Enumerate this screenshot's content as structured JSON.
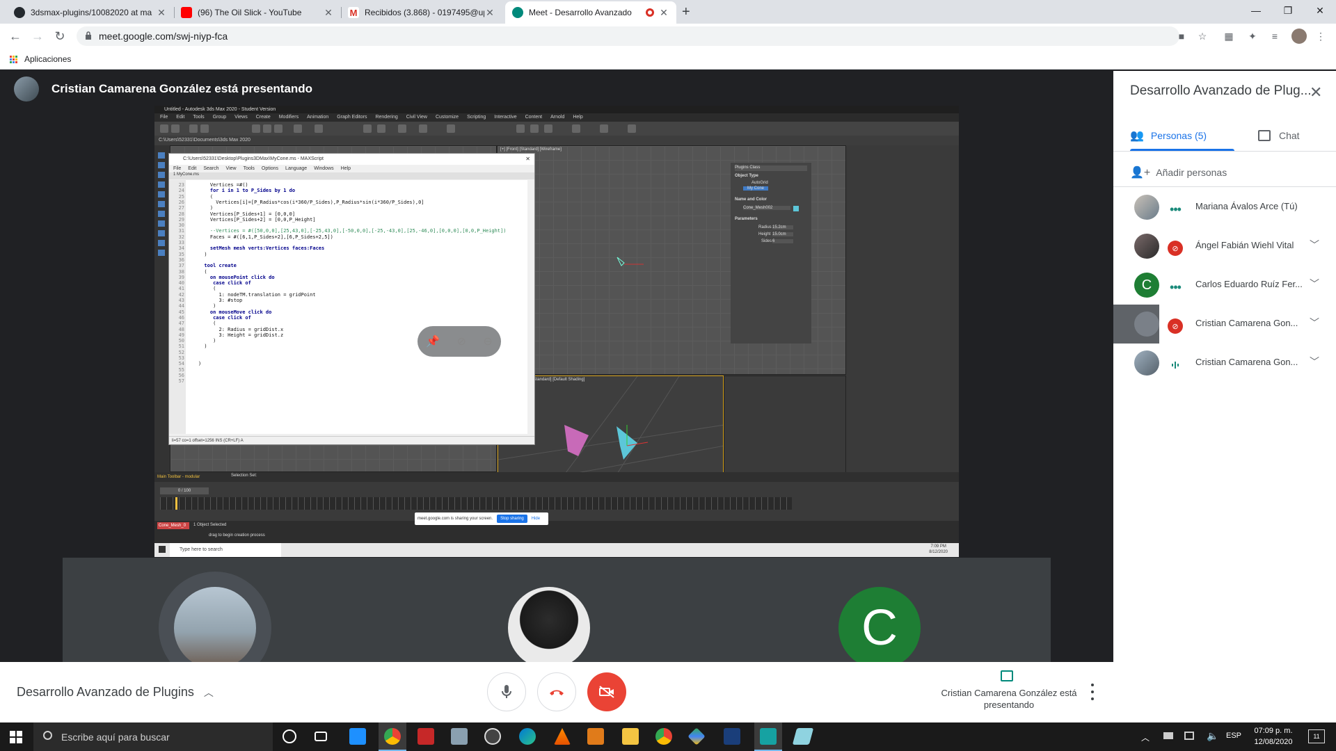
{
  "browser": {
    "tabs": [
      {
        "label": "3dsmax-plugins/10082020 at ma",
        "favicon_color": "#24292e"
      },
      {
        "label": "(96) The Oil Slick - YouTube",
        "favicon_color": "#ff0000"
      },
      {
        "label": "Recibidos (3.868) - 0197495@up",
        "favicon_color": "#d93025"
      },
      {
        "label": "Meet - Desarrollo Avanzado",
        "favicon_color": "#00897b"
      }
    ],
    "url": "meet.google.com/swj-niyp-fca",
    "bookmark_apps": "Aplicaciones"
  },
  "meet": {
    "presenter_header": "Cristian Camarena González está presentando",
    "meeting_title": "Desarrollo Avanzado de Plugins",
    "presenting_status": "Cristian Camarena González está presentando",
    "accent": "#1a73e8",
    "end_call_color": "#ea4335"
  },
  "shared_screen": {
    "max_title": "Untitled - Autodesk 3ds Max 2020 - Student Version",
    "max_menu": [
      "File",
      "Edit",
      "Tools",
      "Group",
      "Views",
      "Create",
      "Modifiers",
      "Animation",
      "Graph Editors",
      "Rendering",
      "Civil View",
      "Customize",
      "Scripting",
      "Interactive",
      "Content",
      "Arnold",
      "Help"
    ],
    "max_path": "C:\\Users\\52331\\Documents\\3ds Max 2020",
    "editor_title": "C:\\Users\\52331\\Desktop\\Plugins3DMax\\MyCone.ms - MAXScript",
    "editor_menu": [
      "File",
      "Edit",
      "Search",
      "View",
      "Tools",
      "Options",
      "Language",
      "Windows",
      "Help"
    ],
    "editor_tab": "1 MyCone.ms",
    "code_lines": [
      {
        "n": "23",
        "text": "    Vertices =#()"
      },
      {
        "n": "24",
        "text": "    for i in 1 to P_Sides by 1 do"
      },
      {
        "n": "25",
        "text": "    ("
      },
      {
        "n": "26",
        "text": "      Vertices[i]=[P_Radius*cos(i*360/P_Sides),P_Radius*sin(i*360/P_Sides),0]"
      },
      {
        "n": "27",
        "text": "    )"
      },
      {
        "n": "28",
        "text": "    Vertices[P_Sides+1] = [0,0,0]"
      },
      {
        "n": "29",
        "text": "    Vertices[P_Sides+2] = [0,0,P_Height]"
      },
      {
        "n": "30",
        "text": ""
      },
      {
        "n": "31",
        "text": "    --Vertices = #([50,0,0],[25,43,0],[-25,43,0],[-50,0,0],[-25,-43,0],[25,-46,0],[0,0,0],[0,0,P_Height])"
      },
      {
        "n": "32",
        "text": "    Faces = #([6,1,P_Sides+2],[6,P_Sides+2,5])"
      },
      {
        "n": "33",
        "text": ""
      },
      {
        "n": "34",
        "text": "    setMesh mesh verts:Vertices faces:Faces"
      },
      {
        "n": "35",
        "text": "  )"
      },
      {
        "n": "36",
        "text": ""
      },
      {
        "n": "37",
        "text": "  tool create"
      },
      {
        "n": "38",
        "text": "  ("
      },
      {
        "n": "39",
        "text": "    on mousePoint click do"
      },
      {
        "n": "40",
        "text": "     case click of"
      },
      {
        "n": "41",
        "text": "     ("
      },
      {
        "n": "42",
        "text": "       1: nodeTM.translation = gridPoint"
      },
      {
        "n": "43",
        "text": "       3: #stop"
      },
      {
        "n": "44",
        "text": "     )"
      },
      {
        "n": "45",
        "text": "    on mouseMove click do"
      },
      {
        "n": "46",
        "text": "     case click of"
      },
      {
        "n": "47",
        "text": "     ("
      },
      {
        "n": "48",
        "text": "       2: Radius = gridDist.x"
      },
      {
        "n": "49",
        "text": "       3: Height = gridDist.z"
      },
      {
        "n": "50",
        "text": "     )"
      },
      {
        "n": "51",
        "text": "  )"
      },
      {
        "n": "52",
        "text": ""
      },
      {
        "n": "53",
        "text": ""
      },
      {
        "n": "54",
        "text": ")"
      },
      {
        "n": "55",
        "text": ""
      },
      {
        "n": "56",
        "text": ""
      },
      {
        "n": "57",
        "text": ""
      }
    ],
    "editor_status": "li=57 co=1 offset=1256 INS (CR+LF) A",
    "viewport_top_label": "[+] [Front] [Standard] [Wireframe]",
    "viewport_persp_label": "[+] [Perspective] [Standard] [Default Shading]",
    "cmd_panel": {
      "category": "Plugins Class",
      "object_type": "Object Type",
      "autogrid": "AutoGrid",
      "mycone": "My Cone",
      "name_color": "Name and Color",
      "object_name": "Cone_Mesh002",
      "parameters": "Parameters",
      "radius_label": "Radius",
      "radius_value": "15.2cm",
      "height_label": "Height",
      "height_value": "15.0cm",
      "sides_label": "Sides",
      "sides_value": "6"
    },
    "timeline_label": "0 / 100",
    "status_selected": "1 Object Selected",
    "status_hint": "drag to begin creation process",
    "object_field": "Cone_Mesh_0",
    "main_toolbar": "Main Toolbar - modular",
    "selection_set": "Selection Set:",
    "share_notice": "meet.google.com is sharing your screen.",
    "stop_sharing": "Stop sharing",
    "hide": "Hide",
    "win_search": "Type here to search",
    "inner_time": "7:09 PM",
    "inner_date": "8/12/2020"
  },
  "participants_panel": {
    "title": "Desarrollo Avanzado de Plug...",
    "tab_people": "Personas (5)",
    "tab_chat": "Chat",
    "add_people": "Añadir personas",
    "people": [
      {
        "name": "Mariana Ávalos Arce (Tú)",
        "status": "speaking-dots",
        "avatar_color": "#8d9aa3"
      },
      {
        "name": "Ángel Fabián Wiehl Vital",
        "status": "muted",
        "avatar_color": "#6f6060"
      },
      {
        "name": "Carlos Eduardo Ruíz Fer...",
        "status": "speaking-dots",
        "avatar_color": "#1e7e34",
        "initial": "C"
      },
      {
        "name": "Cristian Camarena Gon...",
        "status": "muted",
        "avatar_color": "#7a8088"
      },
      {
        "name": "Cristian Camarena Gon...",
        "status": "speaking-bars",
        "avatar_color": "#7a8b99"
      }
    ]
  },
  "tiles": [
    {
      "kind": "photo",
      "color": "#6d7e8c"
    },
    {
      "kind": "photo",
      "color": "#eeeeee"
    },
    {
      "kind": "initial",
      "initial": "C",
      "color": "#1e7e34"
    }
  ],
  "taskbar": {
    "search_placeholder": "Escribe aquí para buscar",
    "lang": "ESP",
    "time": "07:09 p. m.",
    "date": "12/08/2020",
    "notifications": "11"
  }
}
